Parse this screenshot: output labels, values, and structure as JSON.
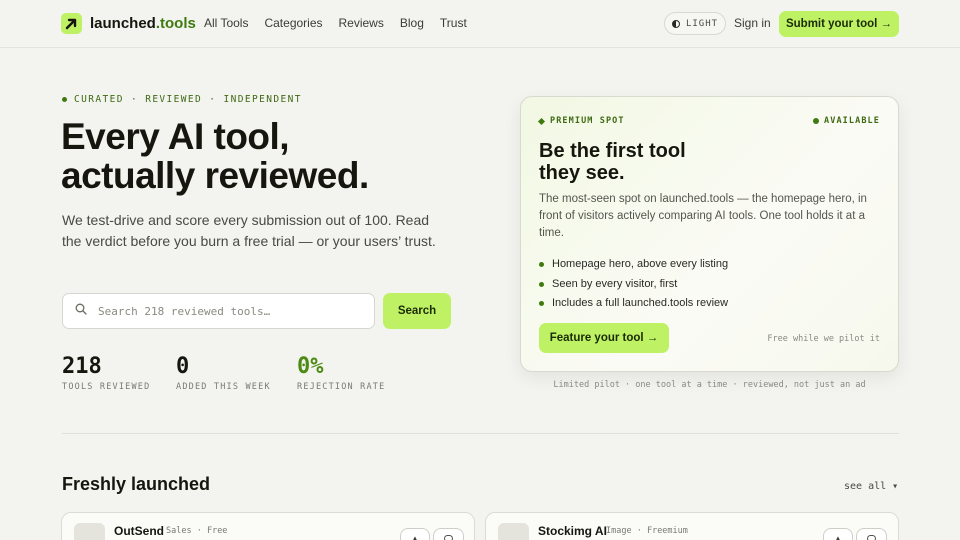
{
  "header": {
    "logo_main": "launched",
    "logo_tld": ".tools",
    "nav": [
      "All Tools",
      "Categories",
      "Reviews",
      "Blog",
      "Trust"
    ],
    "theme_label": "LIGHT",
    "signin": "Sign in",
    "submit": "Submit your tool →"
  },
  "hero": {
    "eyebrow": "CURATED · REVIEWED · INDEPENDENT",
    "title_line1": "Every AI tool,",
    "title_line2": "actually reviewed.",
    "subtitle": "We test-drive and score every submission out of 100. Read the verdict before you burn a free trial — or your users’ trust.",
    "search_placeholder": "Search 218 reviewed tools…",
    "search_button": "Search",
    "stats": [
      {
        "value": "218",
        "label": "TOOLS REVIEWED"
      },
      {
        "value": "0",
        "label": "ADDED THIS WEEK"
      },
      {
        "value": "0%",
        "label": "REJECTION RATE"
      }
    ]
  },
  "premium": {
    "tag": "PREMIUM SPOT",
    "availability": "AVAILABLE",
    "title_line1": "Be the first tool",
    "title_line2": "they see.",
    "description": "The most-seen spot on launched.tools — the homepage hero, in front of visitors actively comparing AI tools. One tool holds it at a time.",
    "bullets": [
      "Homepage hero, above every listing",
      "Seen by every visitor, first",
      "Includes a full launched.tools review"
    ],
    "cta": "Feature your tool →",
    "price_note": "Free while we pilot it",
    "footnote": "Limited pilot · one tool at a time · reviewed, not just an ad"
  },
  "fresh": {
    "title": "Freshly launched",
    "see_all": "see all ▾",
    "tools": [
      {
        "name": "OutSend",
        "category": "Sales",
        "pricing": "Free"
      },
      {
        "name": "Stockimg AI",
        "category": "Image",
        "pricing": "Freemium"
      }
    ]
  },
  "colors": {
    "accent": "#bef264",
    "accent_dark": "#3f7a0f",
    "background": "#f3f3ef"
  }
}
